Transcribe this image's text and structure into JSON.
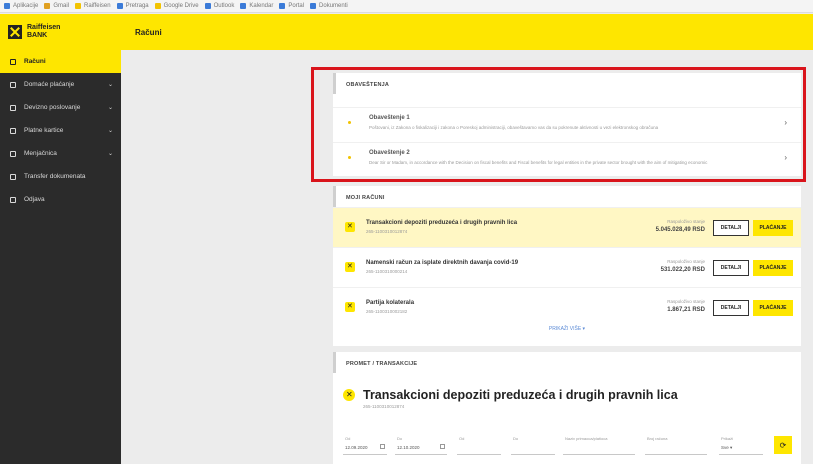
{
  "bookmarks": [
    {
      "label": "Aplikacije",
      "color": "#3b7bd8"
    },
    {
      "label": "Gmail",
      "color": "#e0a020"
    },
    {
      "label": "Raiffeisen",
      "color": "#f2c300"
    },
    {
      "label": "Pretraga",
      "color": "#3b7bd8"
    },
    {
      "label": "Google Drive",
      "color": "#f2c300"
    },
    {
      "label": "Outlook",
      "color": "#3b7bd8"
    },
    {
      "label": "Kalendar",
      "color": "#3b7bd8"
    },
    {
      "label": "Portal",
      "color": "#3b7bd8"
    },
    {
      "label": "Dokumenti",
      "color": "#3b7bd8"
    }
  ],
  "brand": {
    "line1": "Raiffeisen",
    "line2": "BANK",
    "accent": "#fee600",
    "sidebar_bg": "#2b2b2b"
  },
  "sidebar": {
    "items": [
      {
        "label": "Računi",
        "active": true,
        "chevron": false
      },
      {
        "label": "Domaće plaćanje",
        "active": false,
        "chevron": true
      },
      {
        "label": "Devizno poslovanje",
        "active": false,
        "chevron": true
      },
      {
        "label": "Platne kartice",
        "active": false,
        "chevron": true
      },
      {
        "label": "Menjačnica",
        "active": false,
        "chevron": true
      },
      {
        "label": "Transfer dokumenata",
        "active": false,
        "chevron": false
      },
      {
        "label": "Odjava",
        "active": false,
        "chevron": false
      }
    ]
  },
  "header": {
    "title": "Računi"
  },
  "notices": {
    "heading": "OBAVEŠTENJA",
    "items": [
      {
        "title": "Obaveštenje 1",
        "text": "Poštovani, iz Zakona o fiskalizaciji i zakona o Poreskoj administraciji, obaveštavamo vas da su pokrenute aktivnosti u vezi elektronskog obračuna"
      },
      {
        "title": "Obaveštenje 2",
        "text": "Dear Sir or Madam, in accordance with the Decision on fiscal benefits and Fiscal benefits for legal entities in the private sector brought with the aim of mitigating economic"
      }
    ]
  },
  "accounts": {
    "heading": "MOJI RAČUNI",
    "balance_label": "Raspoloživo stanje",
    "details_label": "DETALJI",
    "pay_label": "PLAĆANJE",
    "more_label": "PRIKAŽI VIŠE ▾",
    "items": [
      {
        "name": "Transakcioni depoziti preduzeća i drugih pravnih lica",
        "number": "265-1100310012874",
        "balance": "5.045.028,49 RSD",
        "highlight": true
      },
      {
        "name": "Namenski račun za isplate direktnih davanja covid-19",
        "number": "265-1100310000214",
        "balance": "531.022,20 RSD",
        "highlight": false
      },
      {
        "name": "Partija kolaterala",
        "number": "265-1100310002182",
        "balance": "1.867,21 RSD",
        "highlight": false
      }
    ]
  },
  "transactions": {
    "heading": "PROMET / TRANSAKCIJE",
    "title": "Transakcioni depoziti preduzeća i drugih pravnih lica",
    "number": "265-1100310012874",
    "filters": [
      {
        "label": "Od",
        "value": "12.09.2020",
        "calendar": true
      },
      {
        "label": "Do",
        "value": "12.10.2020",
        "calendar": true
      },
      {
        "label": "Od",
        "value": "",
        "calendar": false
      },
      {
        "label": "Do",
        "value": "",
        "calendar": false
      },
      {
        "label": "Naziv primaoca/platioca",
        "value": "",
        "calendar": false
      },
      {
        "label": "Broj računa",
        "value": "",
        "calendar": false
      },
      {
        "label": "Prikaži",
        "value": "Sve ▾",
        "calendar": false
      }
    ],
    "refresh_icon": "refresh-icon"
  },
  "annotation_color": "#d9141b"
}
